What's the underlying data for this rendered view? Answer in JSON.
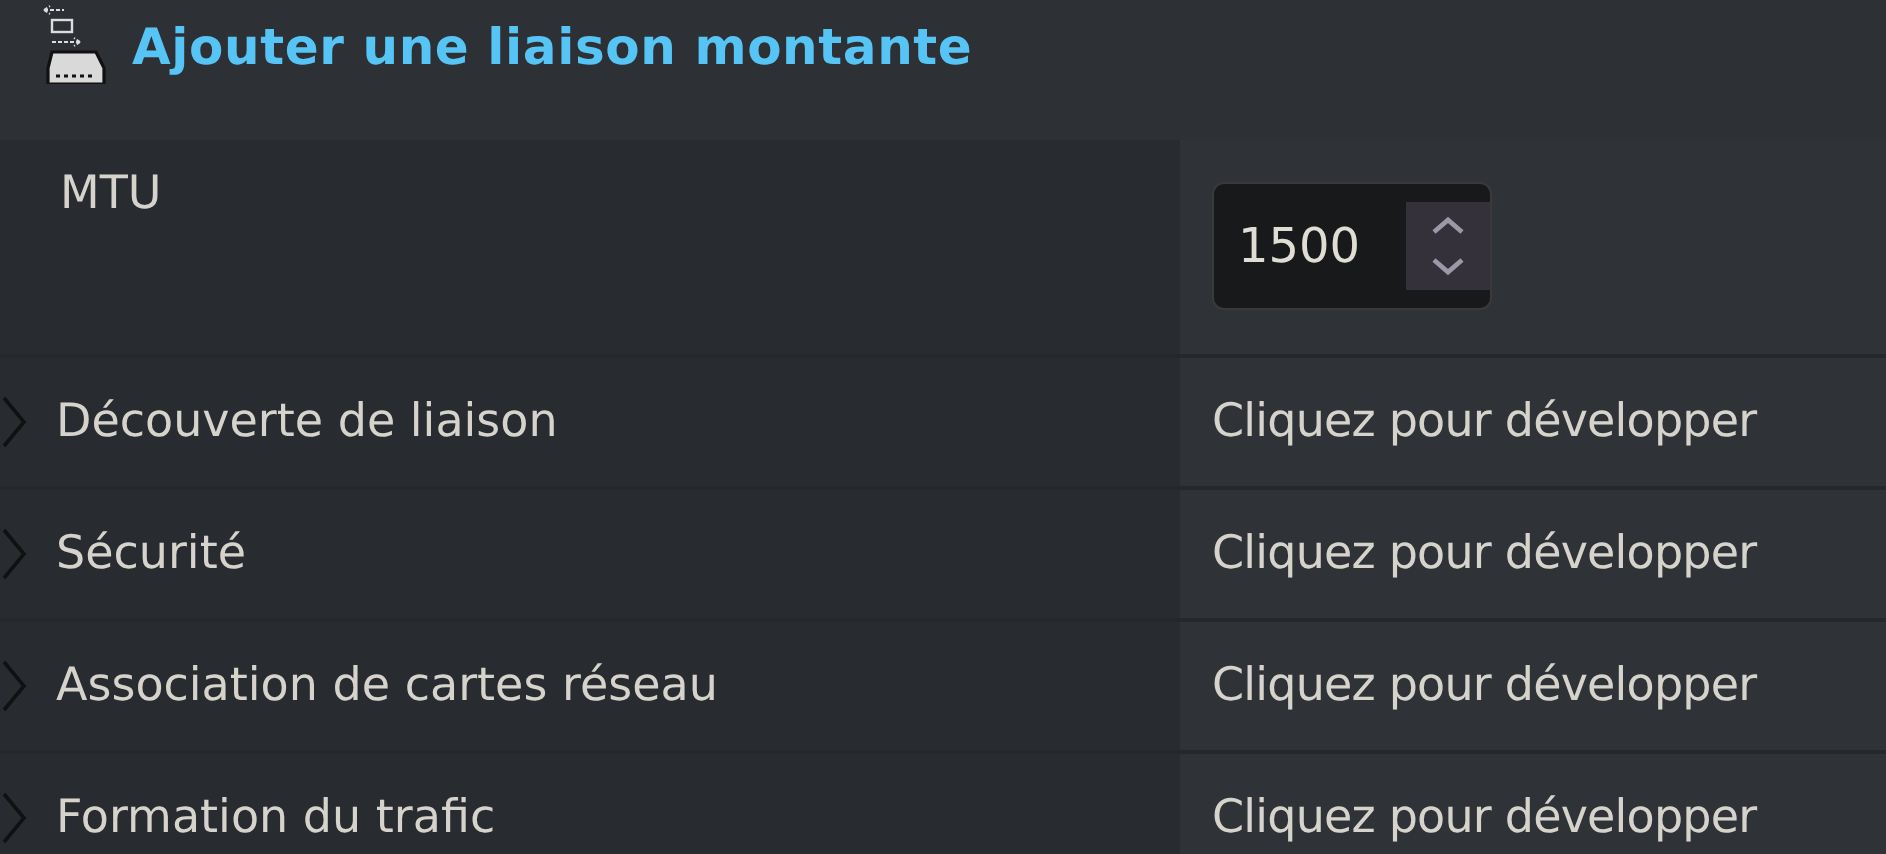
{
  "header": {
    "title": "Ajouter une liaison montante"
  },
  "mtu": {
    "label": "MTU",
    "value": "1500"
  },
  "sections": [
    {
      "label": "Découverte de liaison",
      "hint": "Cliquez pour développer",
      "expanded": false
    },
    {
      "label": "Sécurité",
      "hint": "Cliquez pour développer",
      "expanded": false
    },
    {
      "label": "Association de cartes réseau",
      "hint": "Cliquez pour développer",
      "expanded": false
    },
    {
      "label": "Formation du trafic",
      "hint": "Cliquez pour développer",
      "expanded": false
    }
  ]
}
